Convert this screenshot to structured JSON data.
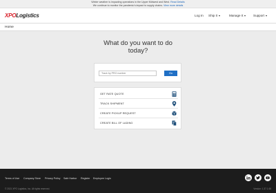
{
  "alert": {
    "line1_prefix": "Winter weather is impacting operations in the Upper Midwest and West.",
    "line1_link": "Read Details",
    "line2_prefix": "We continue to monitor the pandemic's impact to supply chains.",
    "line2_link": "View more details"
  },
  "logo": {
    "part1": "XPO",
    "part2": "Logistics"
  },
  "nav": {
    "login": "Log In",
    "ship": "Ship It",
    "manage": "Manage It",
    "support": "Support"
  },
  "breadcrumb": {
    "home": "Home"
  },
  "hero": {
    "line1": "What do you want to do",
    "line2": "today?"
  },
  "search": {
    "placeholder": "Track by PRO number",
    "button": "Go"
  },
  "actions": [
    {
      "label": "GET RATE QUOTE",
      "icon": "calculator-icon"
    },
    {
      "label": "TRACK SHIPMENT",
      "icon": "map-pin-icon"
    },
    {
      "label": "CREATE PICKUP REQUEST",
      "icon": "box-icon"
    },
    {
      "label": "CREATE BILL OF LADING",
      "icon": "documents-icon"
    }
  ],
  "footer": {
    "links": [
      "Terms of Use",
      "Company Store",
      "Privacy Policy",
      "Safe Harbor",
      "Register",
      "Employee Login"
    ],
    "copyright": "© 2021 XPO Logistics, Inc. All rights reserved.",
    "version": "Version: 1.37.1.65",
    "social": [
      "linkedin-icon",
      "twitter-icon",
      "youtube-icon"
    ]
  },
  "colors": {
    "brand_red": "#d8202a",
    "accent_blue": "#1f6fc5",
    "footer_bg": "#1c1c1c",
    "page_bg": "#ececec"
  }
}
